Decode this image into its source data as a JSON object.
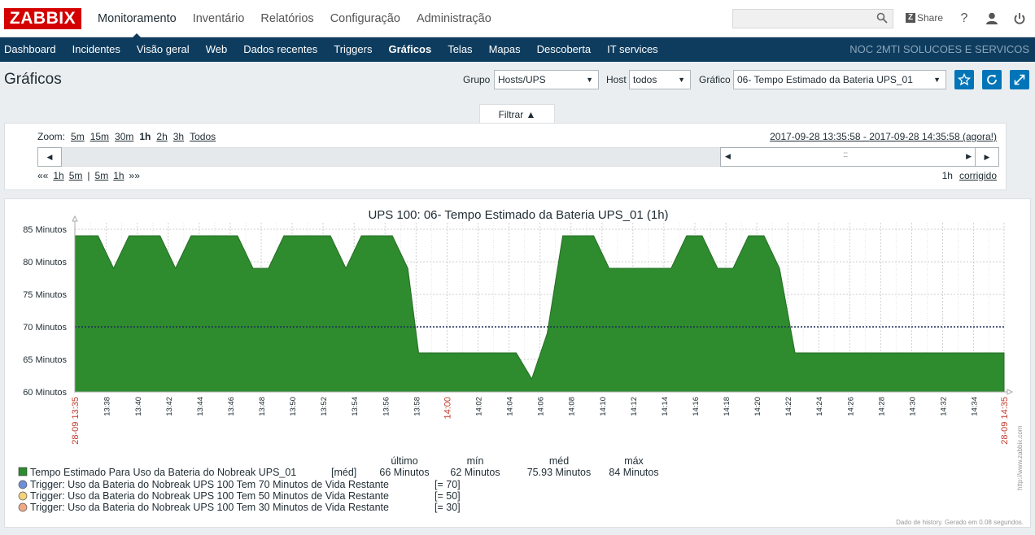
{
  "header": {
    "logo": "ZABBIX",
    "nav": [
      "Monitoramento",
      "Inventário",
      "Relatórios",
      "Configuração",
      "Administração"
    ],
    "active_nav": 0,
    "search_value": "",
    "share_label": "Share",
    "help_label": "?"
  },
  "subnav": {
    "items": [
      "Dashboard",
      "Incidentes",
      "Visão geral",
      "Web",
      "Dados recentes",
      "Triggers",
      "Gráficos",
      "Telas",
      "Mapas",
      "Descoberta",
      "IT services"
    ],
    "active": 6,
    "organization": "NOC 2MTI SOLUCOES E SERVICOS"
  },
  "page": {
    "title": "Gráficos",
    "group_label": "Grupo",
    "group_value": "Hosts/UPS",
    "host_label": "Host",
    "host_value": "todos",
    "graph_label": "Gráfico",
    "graph_value": "06- Tempo Estimado da Bateria UPS_01"
  },
  "filter": {
    "tab_label": "Filtrar ▲",
    "zoom_label": "Zoom:",
    "zoom_options": [
      "5m",
      "15m",
      "30m",
      "1h",
      "2h",
      "3h",
      "Todos"
    ],
    "zoom_current": "1h",
    "period_from": "2017-09-28 13:35:58",
    "period_sep": " - ",
    "period_to": "2017-09-28 14:35:58 (agora!)",
    "nav_back_all": "««",
    "nav_back": [
      "1h",
      "5m"
    ],
    "nav_sep": "|",
    "nav_fwd": [
      "5m",
      "1h"
    ],
    "nav_fwd_all": "»»",
    "period_length": "1h",
    "fixed_label": "corrigido"
  },
  "chart_data": {
    "type": "area",
    "title": "UPS 100: 06- Tempo Estimado da Bateria UPS_01 (1h)",
    "y_tick_labels": [
      "85 Minutos",
      "80 Minutos",
      "75 Minutos",
      "70 Minutos",
      "65 Minutos",
      "60 Minutos"
    ],
    "y_ticks": [
      85,
      80,
      75,
      70,
      65,
      60
    ],
    "ylim": [
      60,
      85
    ],
    "xlim": [
      "13:35:58",
      "14:35:58"
    ],
    "x_tick_labels": [
      "28-09 13:35",
      "13:38",
      "13:40",
      "13:42",
      "13:44",
      "13:46",
      "13:48",
      "13:50",
      "13:52",
      "13:54",
      "13:56",
      "13:58",
      "14:00",
      "14:02",
      "14:04",
      "14:06",
      "14:08",
      "14:10",
      "14:12",
      "14:14",
      "14:16",
      "14:18",
      "14:20",
      "14:22",
      "14:24",
      "14:26",
      "14:28",
      "14:30",
      "14:32",
      "14:34",
      "28-09 14:35"
    ],
    "x_tick_minutes": [
      0,
      2.033,
      4.033,
      6.033,
      8.033,
      10.033,
      12.033,
      14.033,
      16.033,
      18.033,
      20.033,
      22.033,
      24.033,
      26.033,
      28.033,
      30.033,
      32.033,
      34.033,
      36.033,
      38.033,
      40.033,
      42.033,
      44.033,
      46.033,
      48.033,
      50.033,
      52.033,
      54.033,
      56.033,
      58.033,
      60
    ],
    "red_ticks": [
      "28-09 13:35",
      "14:00",
      "28-09 14:35"
    ],
    "series": [
      {
        "name": "Tempo Estimado Para Uso da Bateria do Nobreak UPS_01",
        "color": "#2e8b2e",
        "x_minutes": [
          0,
          1.5,
          2.5,
          3.5,
          5.5,
          6.5,
          7.5,
          10.5,
          11.5,
          12.5,
          13.5,
          16.5,
          17.5,
          18.5,
          20.5,
          21.5,
          22.2,
          28.5,
          29.5,
          30.5,
          31.5,
          33.5,
          34.5,
          38.5,
          39.5,
          40.5,
          41.5,
          42.5,
          43.5,
          44.5,
          45.5,
          46.5,
          60
        ],
        "values": [
          84,
          84,
          79,
          84,
          84,
          79,
          84,
          84,
          79,
          79,
          84,
          84,
          79,
          84,
          84,
          79,
          66,
          66,
          62,
          69,
          84,
          84,
          79,
          79,
          84,
          84,
          79,
          79,
          84,
          84,
          79,
          66,
          66
        ]
      }
    ],
    "trigger_lines": [
      {
        "name": "Trigger: Uso da Bateria do Nobreak UPS 100 Tem 70 Minutos de Vida Restante",
        "value_label": "[= 70]",
        "value": 70,
        "color": "#6e8fd8"
      },
      {
        "name": "Trigger: Uso da Bateria do Nobreak UPS 100 Tem 50 Minutos de Vida Restante",
        "value_label": "[= 50]",
        "value": 50,
        "color": "#f3d27a"
      },
      {
        "name": "Trigger: Uso da Bateria do Nobreak UPS 100 Tem 30 Minutos de Vida Restante",
        "value_label": "[= 30]",
        "value": 30,
        "color": "#f0a886"
      }
    ],
    "legend_headers": [
      "último",
      "mín",
      "méd",
      "máx"
    ],
    "legend_func": "[méd]",
    "legend_values": [
      "66 Minutos",
      "62 Minutos",
      "75.93 Minutos",
      "84 Minutos"
    ],
    "footer": "Dado de history. Gerado em 0.08 segundos.",
    "watermark": "http://www.zabbix.com"
  }
}
